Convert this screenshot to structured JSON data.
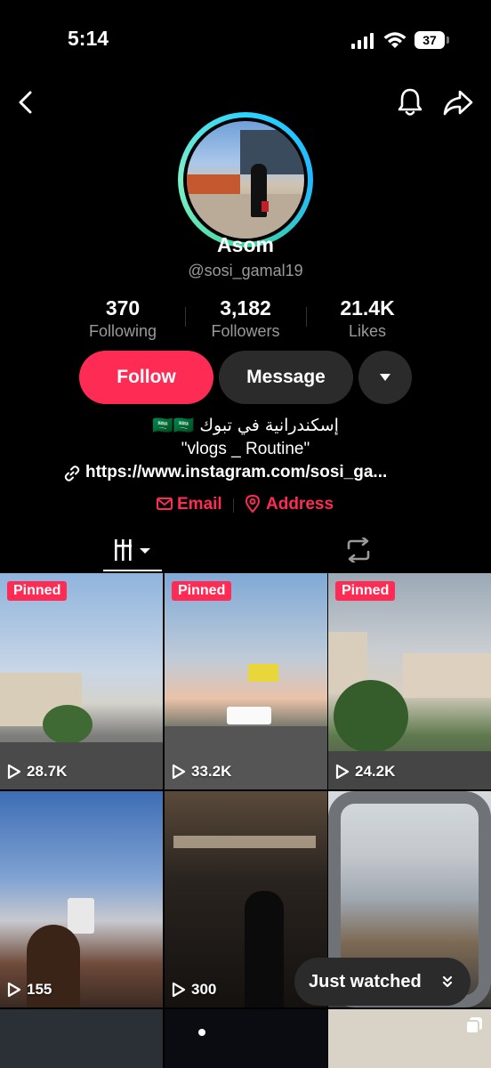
{
  "status_bar": {
    "time": "5:14",
    "battery": "37"
  },
  "profile": {
    "name": "Asom",
    "handle": "@sosi_gamal19",
    "stats": [
      {
        "value": "370",
        "label": "Following"
      },
      {
        "value": "3,182",
        "label": "Followers"
      },
      {
        "value": "21.4K",
        "label": "Likes"
      }
    ],
    "bio_line1": "إسكندرانية في تبوك 🇸🇦🇸🇦",
    "bio_line2": "\"vlogs _ Routine\"",
    "link": "https://www.instagram.com/sosi_ga...",
    "email_label": "Email",
    "address_label": "Address"
  },
  "buttons": {
    "follow": "Follow",
    "message": "Message"
  },
  "videos": [
    {
      "pinned": "Pinned",
      "views": "28.7K"
    },
    {
      "pinned": "Pinned",
      "views": "33.2K"
    },
    {
      "pinned": "Pinned",
      "views": "24.2K"
    },
    {
      "views": "155"
    },
    {
      "views": "300"
    },
    {
      "views": ""
    }
  ],
  "just_watched": "Just watched",
  "colors": {
    "accent": "#fe2c55",
    "button_dark": "#2b2b2b",
    "muted": "#9a9a9a"
  }
}
